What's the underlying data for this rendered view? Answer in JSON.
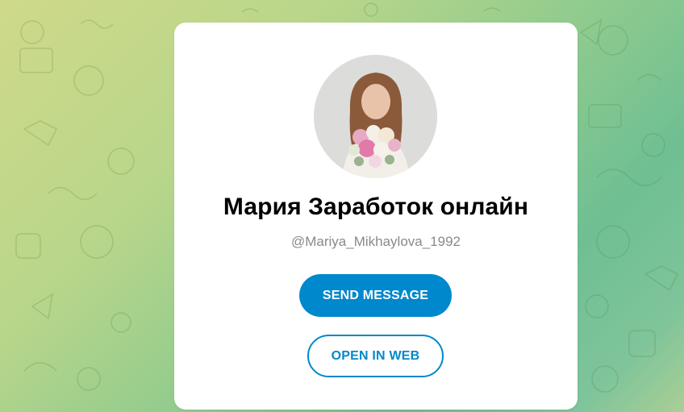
{
  "profile": {
    "name": "Мария Заработок онлайн",
    "username": "@Mariya_Mikhaylova_1992",
    "avatar_icon": "profile-photo-woman-with-flowers"
  },
  "actions": {
    "send_message_label": "SEND MESSAGE",
    "open_in_web_label": "OPEN IN WEB"
  },
  "colors": {
    "accent": "#0088cc",
    "card": "#ffffff",
    "username_text": "#8a8a8a",
    "background_gradient": [
      "#cfd98a",
      "#8fcb8e",
      "#6fbf93"
    ]
  }
}
